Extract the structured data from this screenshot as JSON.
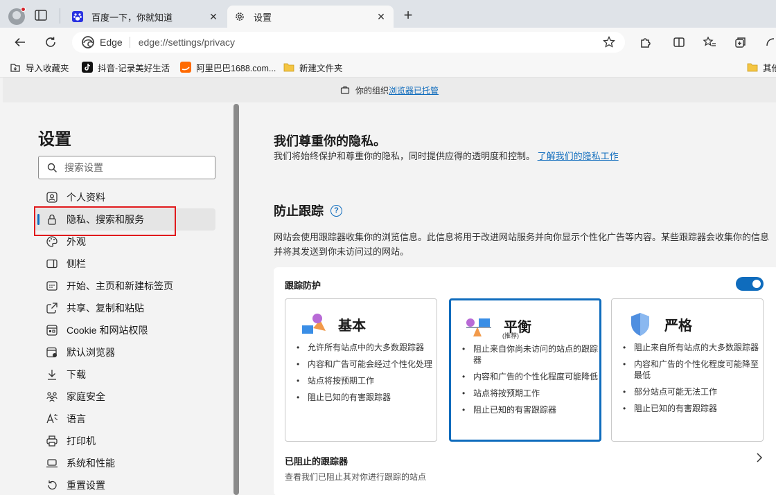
{
  "tabs": [
    {
      "title": "百度一下，你就知道",
      "icon": "baidu-paw-icon",
      "active": false
    },
    {
      "title": "设置",
      "icon": "gear-icon",
      "active": true
    }
  ],
  "toolbar": {
    "address_brand": "Edge",
    "url": "edge://settings/privacy"
  },
  "favorites": [
    {
      "label": "导入收藏夹",
      "icon": "import-icon"
    },
    {
      "label": "抖音-记录美好生活",
      "icon": "tiktok-icon"
    },
    {
      "label": "阿里巴巴1688.com...",
      "icon": "alibaba-icon"
    },
    {
      "label": "新建文件夹",
      "icon": "folder-icon"
    },
    {
      "label": "其他",
      "icon": "folder-icon"
    }
  ],
  "banner": {
    "text": "你的组织",
    "link": "浏览器已托管"
  },
  "sidebar": {
    "title": "设置",
    "search_placeholder": "搜索设置",
    "items": [
      {
        "label": "个人资料",
        "icon": "profile-icon"
      },
      {
        "label": "隐私、搜索和服务",
        "icon": "lock-icon",
        "active": true
      },
      {
        "label": "外观",
        "icon": "palette-icon"
      },
      {
        "label": "侧栏",
        "icon": "sidebar-icon"
      },
      {
        "label": "开始、主页和新建标签页",
        "icon": "home-grid-icon"
      },
      {
        "label": "共享、复制和粘贴",
        "icon": "share-icon"
      },
      {
        "label": "Cookie 和网站权限",
        "icon": "cookie-icon"
      },
      {
        "label": "默认浏览器",
        "icon": "browser-icon"
      },
      {
        "label": "下载",
        "icon": "download-icon"
      },
      {
        "label": "家庭安全",
        "icon": "family-icon"
      },
      {
        "label": "语言",
        "icon": "language-icon"
      },
      {
        "label": "打印机",
        "icon": "printer-icon"
      },
      {
        "label": "系统和性能",
        "icon": "laptop-icon"
      },
      {
        "label": "重置设置",
        "icon": "reset-icon"
      }
    ]
  },
  "main": {
    "privacy_heading": "我们尊重你的隐私。",
    "privacy_text": "我们将始终保护和尊重你的隐私，同时提供应得的透明度和控制。",
    "privacy_link": "了解我们的隐私工作",
    "tracking_heading": "防止跟踪",
    "tracking_desc": "网站会使用跟踪器收集你的浏览信息。此信息将用于改进网站服务并向你显示个性化广告等内容。某些跟踪器会收集你的信息并将其发送到你未访问过的网站。",
    "card_title": "跟踪防护",
    "toggle_on": true,
    "options": [
      {
        "name": "基本",
        "sub": "",
        "selected": false,
        "bullets": [
          "允许所有站点中的大多数跟踪器",
          "内容和广告可能会经过个性化处理",
          "站点将按预期工作",
          "阻止已知的有害跟踪器"
        ]
      },
      {
        "name": "平衡",
        "sub": "(推荐)",
        "selected": true,
        "bullets": [
          "阻止来自你尚未访问的站点的跟踪器",
          "内容和广告的个性化程度可能降低",
          "站点将按预期工作",
          "阻止已知的有害跟踪器"
        ]
      },
      {
        "name": "严格",
        "sub": "",
        "selected": false,
        "bullets": [
          "阻止来自所有站点的大多数跟踪器",
          "内容和广告的个性化程度可能降至最低",
          "部分站点可能无法工作",
          "阻止已知的有害跟踪器"
        ]
      }
    ],
    "blocked_title": "已阻止的跟踪器",
    "blocked_sub": "查看我们已阻止其对你进行跟踪的站点"
  },
  "colors": {
    "accent": "#0f6cbd",
    "highlight": "#e0191c"
  }
}
